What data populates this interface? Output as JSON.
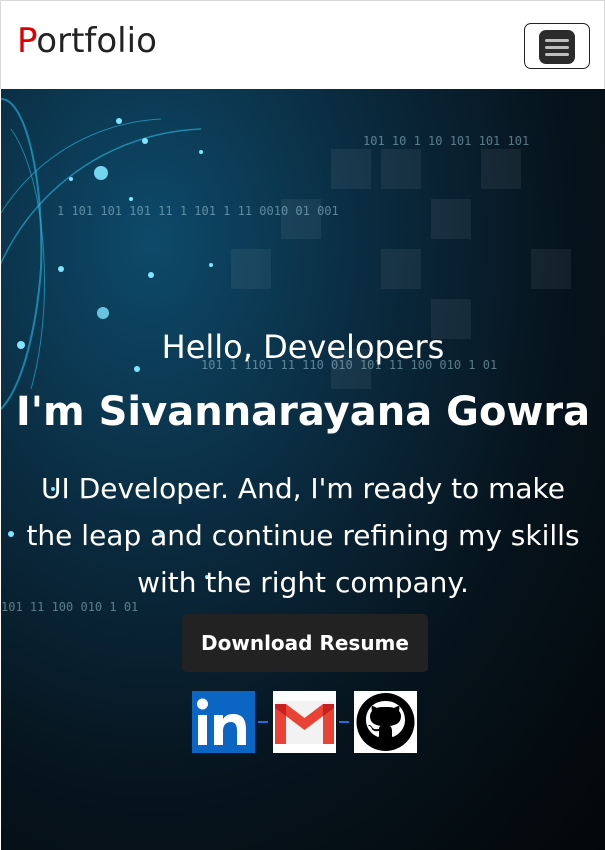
{
  "navbar": {
    "brand_first_letter": "P",
    "brand_rest": "ortfolio",
    "menu_icon": "hamburger-menu-icon"
  },
  "hero": {
    "greeting": "Hello, Developers",
    "name": "I'm Sivannarayana Gowra",
    "tagline": "UI Developer. And, I'm ready to make the leap and continue refining my skills with the right company.",
    "download_label": "Download Resume",
    "background_binary_text": [
      "101 10 1 10  101 101  101",
      "1 101  101  101  11 1   101 1 11   0010  01 001",
      "101 1 1101  11 110 010 101 11 100  010 1 01",
      "101 11 100  010 1 01"
    ],
    "socials": [
      {
        "icon": "linkedin-icon",
        "color": "#0a66c2"
      },
      {
        "icon": "gmail-icon",
        "color": "#ea4335"
      },
      {
        "icon": "github-icon",
        "color": "#000000"
      }
    ]
  },
  "colors": {
    "brand_accent": "#e00000",
    "button_bg": "#222222",
    "separator": "#1e6fd9"
  }
}
